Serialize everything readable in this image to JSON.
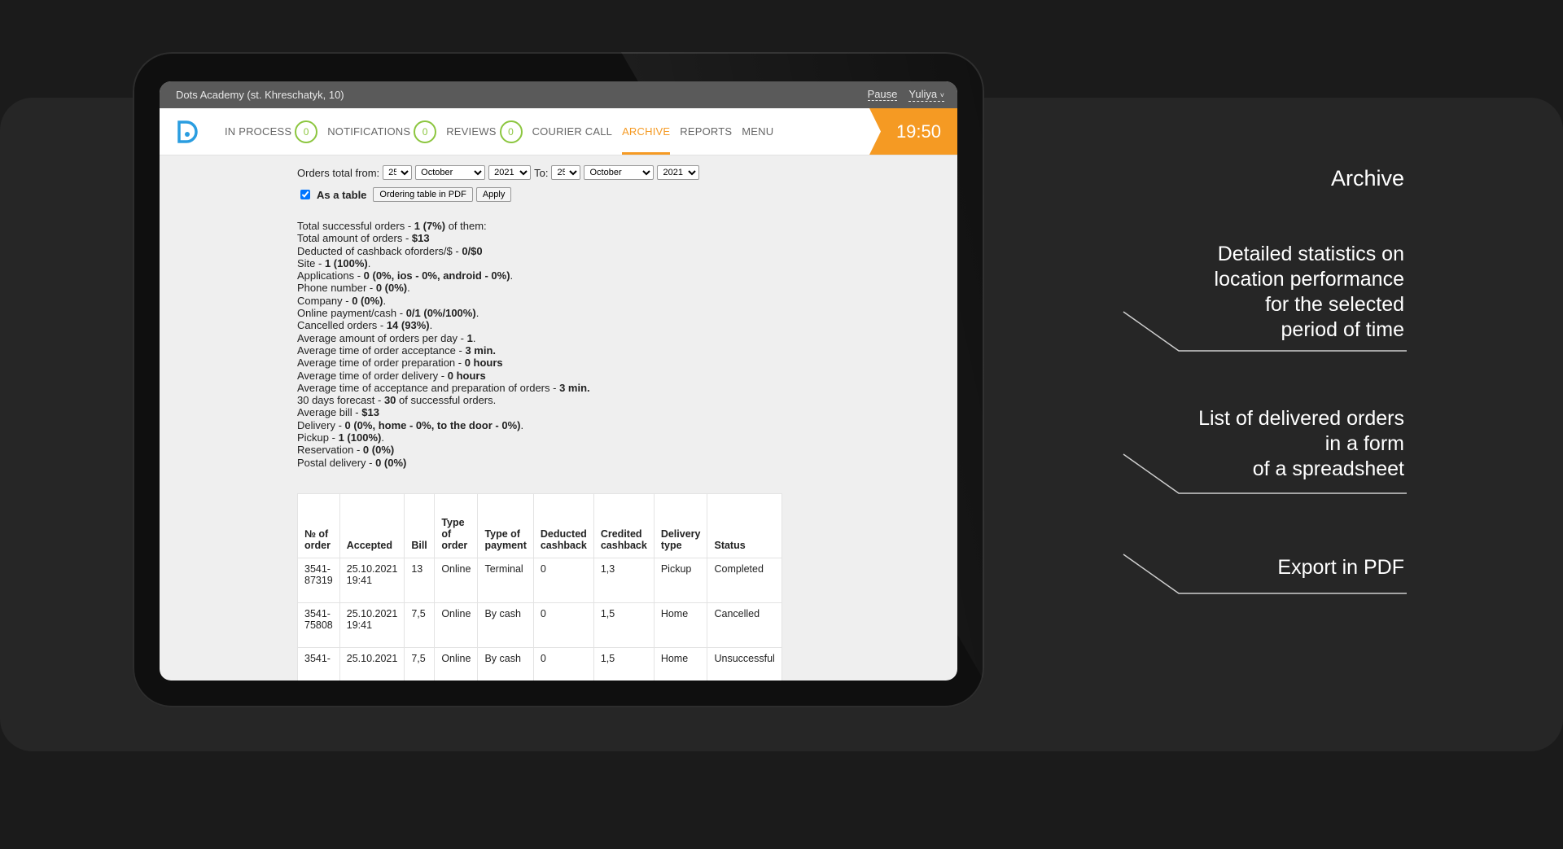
{
  "window": {
    "title": "Dots Academy (st. Khreschatyk, 10)",
    "pause_label": "Pause",
    "user_label": "Yuliya"
  },
  "nav": {
    "items": [
      {
        "label": "IN PROCESS",
        "count": "0"
      },
      {
        "label": "NOTIFICATIONS",
        "count": "0"
      },
      {
        "label": "REVIEWS",
        "count": "0"
      },
      {
        "label": "COURIER CALL"
      },
      {
        "label": "ARCHIVE",
        "active": true
      },
      {
        "label": "REPORTS"
      },
      {
        "label": "MENU"
      }
    ],
    "clock": "19:50",
    "accent": "#f59a23",
    "badge_color": "#8cc63f",
    "logo_color": "#2a9de0"
  },
  "filters": {
    "from_label": "Orders total from:",
    "to_label": "To:",
    "from_day": "25",
    "from_month": "October",
    "from_year": "2021",
    "to_day": "25",
    "to_month": "October",
    "to_year": "2021",
    "as_table_label": "As a table",
    "as_table_checked": true,
    "pdf_button": "Ordering table in PDF",
    "apply_button": "Apply"
  },
  "stats": [
    {
      "label": "Total successful orders - ",
      "value": "1 (7%)",
      "suffix": " of them:"
    },
    {
      "label": "Total amount of orders - ",
      "value": "$13",
      "suffix": ""
    },
    {
      "label": "Deducted of cashback oforders/$ - ",
      "value": "0/$0",
      "suffix": ""
    },
    {
      "label": "Site - ",
      "value": "1 (100%)",
      "suffix": "."
    },
    {
      "label": "Applications - ",
      "value": "0 (0%, ios - 0%, android - 0%)",
      "suffix": "."
    },
    {
      "label": "Phone number - ",
      "value": "0 (0%)",
      "suffix": "."
    },
    {
      "label": "Company - ",
      "value": "0 (0%)",
      "suffix": "."
    },
    {
      "label": "Online payment/cash - ",
      "value": "0/1 (0%/100%)",
      "suffix": "."
    },
    {
      "label": "Cancelled orders - ",
      "value": "14 (93%)",
      "suffix": "."
    },
    {
      "label": "Average amount of orders per day - ",
      "value": "1",
      "suffix": "."
    },
    {
      "label": "Average time of order acceptance - ",
      "value": "3 min.",
      "suffix": ""
    },
    {
      "label": "Average time of order preparation - ",
      "value": "0 hours",
      "suffix": ""
    },
    {
      "label": "Average time of order delivery - ",
      "value": "0 hours",
      "suffix": ""
    },
    {
      "label": "Average time of acceptance and preparation of orders - ",
      "value": "3 min.",
      "suffix": ""
    },
    {
      "label": "30 days forecast - ",
      "value": "30",
      "suffix": " of successful orders."
    },
    {
      "label": "Average bill - ",
      "value": "$13",
      "suffix": ""
    },
    {
      "label": "Delivery - ",
      "value": "0 (0%, home - 0%, to the door - 0%)",
      "suffix": "."
    },
    {
      "label": "Pickup - ",
      "value": "1 (100%)",
      "suffix": "."
    },
    {
      "label": "Reservation - ",
      "value": "0 (0%)",
      "suffix": ""
    },
    {
      "label": "Postal delivery - ",
      "value": "0 (0%)",
      "suffix": ""
    }
  ],
  "table": {
    "headers": [
      "№ of order",
      "Accepted",
      "Bill",
      "Type of order",
      "Type of payment",
      "Deducted cashback",
      "Credited cashback",
      "Delivery type",
      "Status"
    ],
    "rows": [
      [
        "3541-87319",
        "25.10.2021 19:41",
        "13",
        "Online",
        "Terminal",
        "0",
        "1,3",
        "Pickup",
        "Completed"
      ],
      [
        "3541-75808",
        "25.10.2021 19:41",
        "7,5",
        "Online",
        "By cash",
        "0",
        "1,5",
        "Home",
        "Cancelled"
      ],
      [
        "3541-",
        "25.10.2021",
        "7,5",
        "Online",
        "By cash",
        "0",
        "1,5",
        "Home",
        "Unsuccessful"
      ]
    ]
  },
  "captions": {
    "title": "Archive",
    "items": [
      "Detailed statistics on\nlocation performance\nfor the selected\nperiod of time",
      "List of delivered orders\nin a form\nof a spreadsheet",
      "Export in PDF"
    ]
  }
}
